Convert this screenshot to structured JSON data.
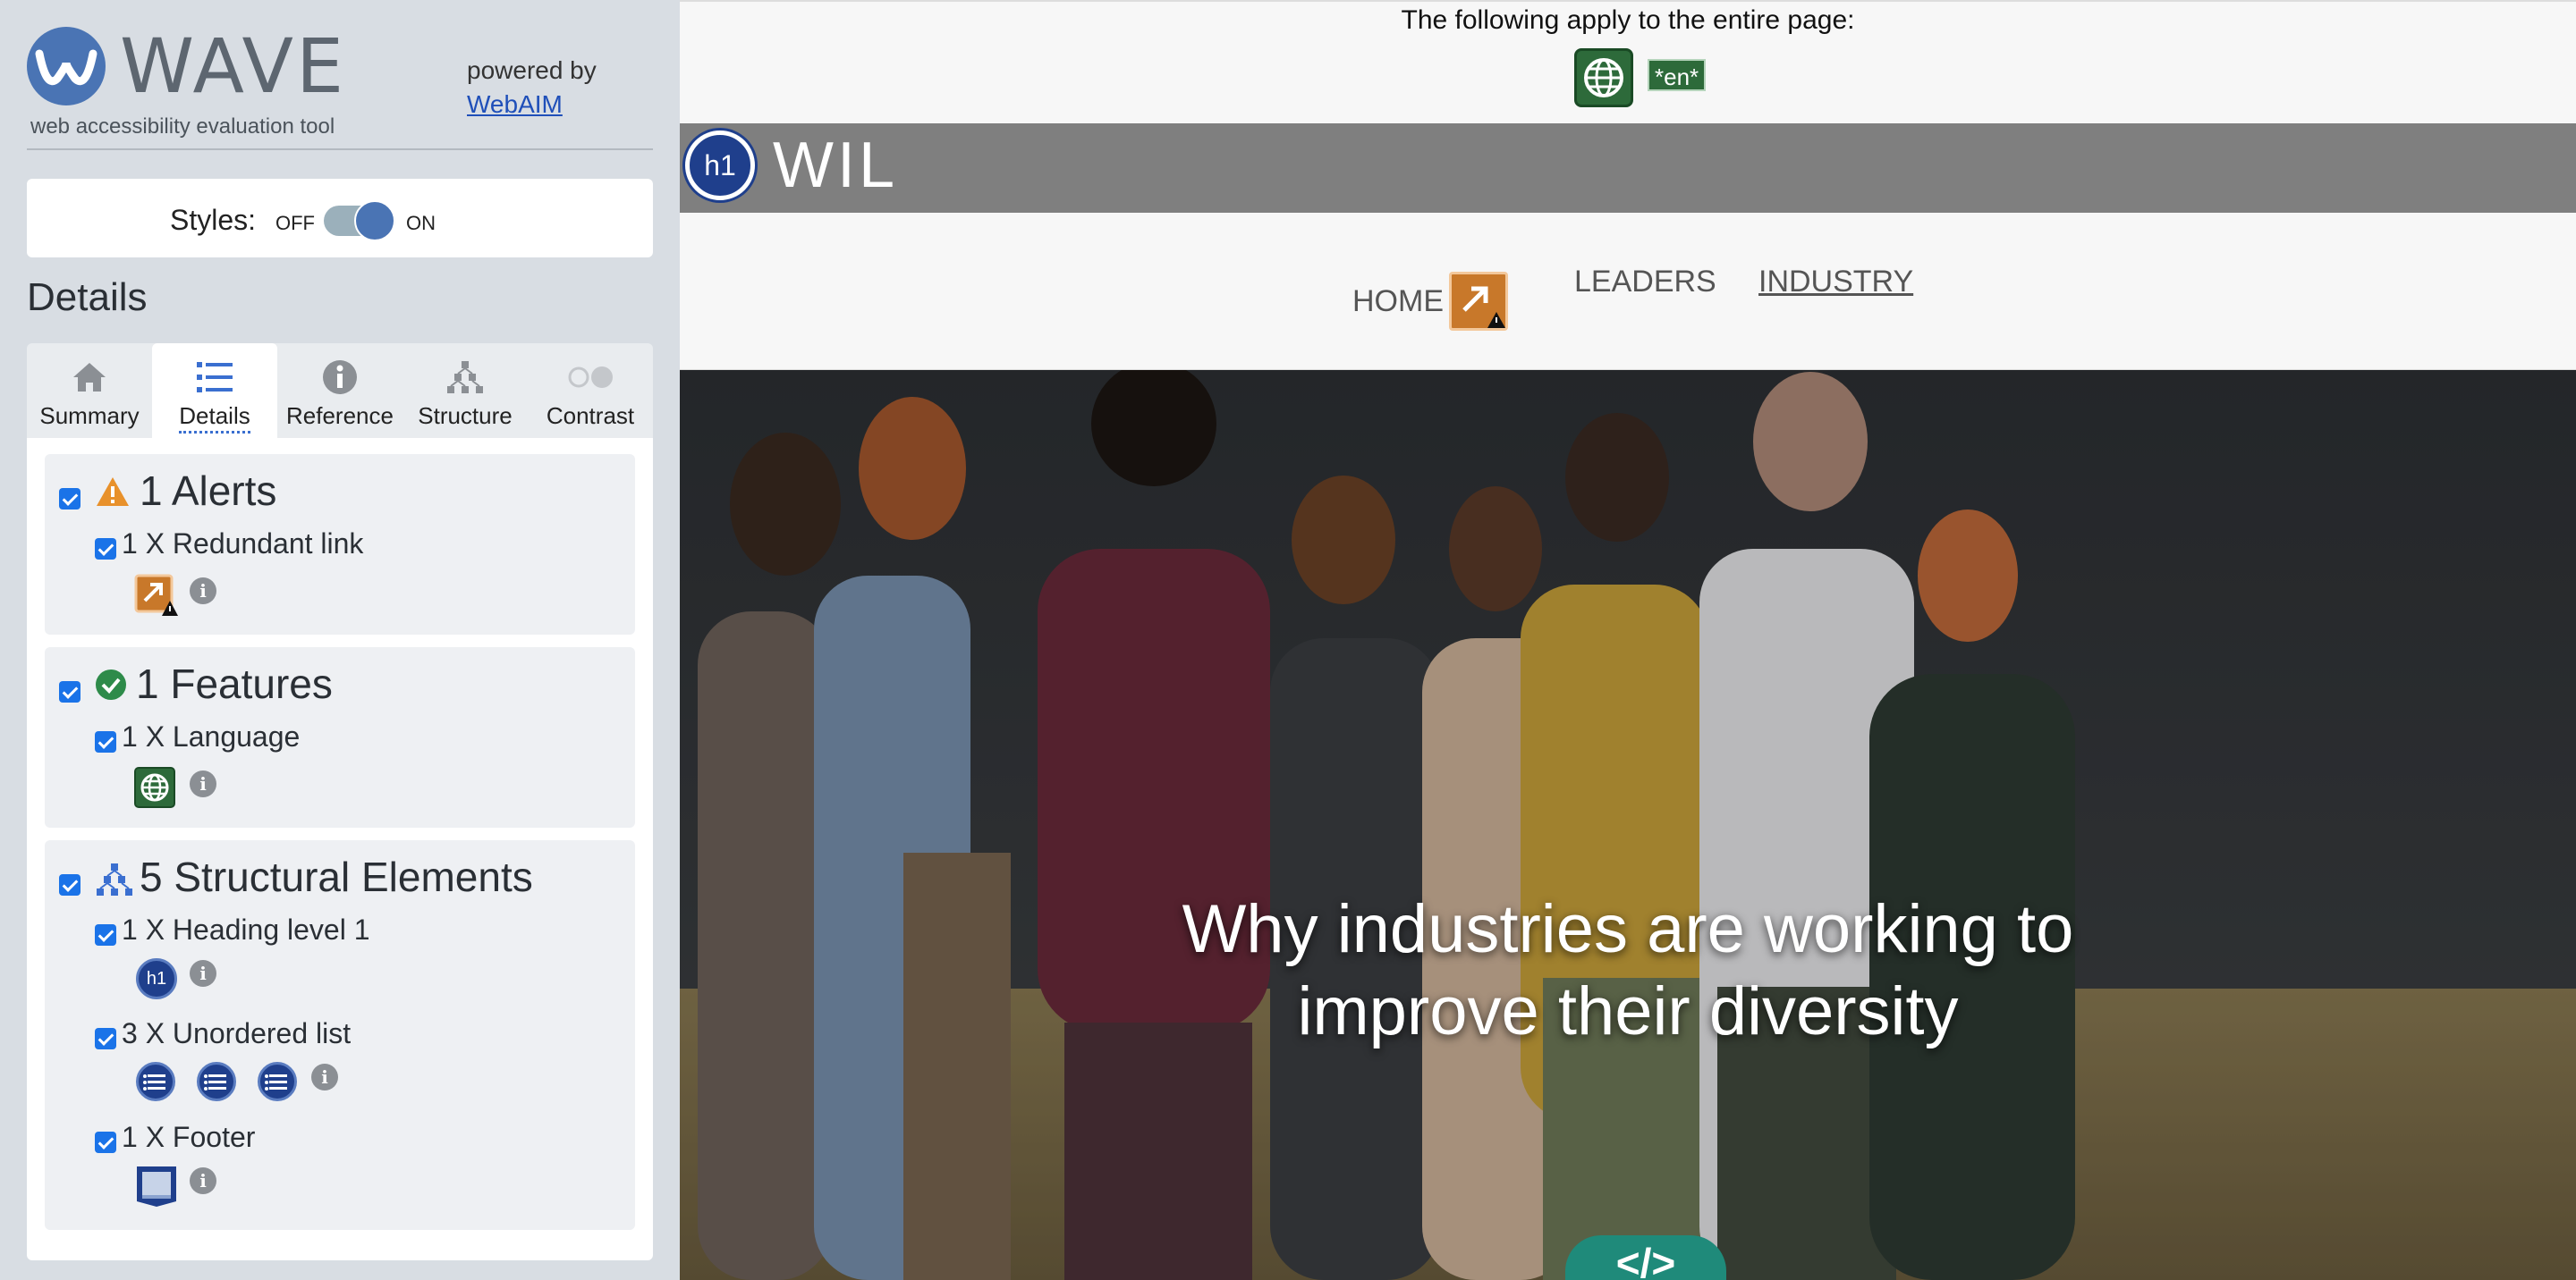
{
  "wave": {
    "logo_word": "WAVE",
    "logo_subtitle": "web accessibility evaluation tool",
    "powered_by": "powered by",
    "webaim_link": "WebAIM",
    "styles_label": "Styles:",
    "styles_off": "OFF",
    "styles_on": "ON",
    "styles_state": "on",
    "details_heading": "Details",
    "tabs": [
      {
        "label": "Summary",
        "icon": "home-icon"
      },
      {
        "label": "Details",
        "icon": "list-icon",
        "active": true
      },
      {
        "label": "Reference",
        "icon": "info-icon"
      },
      {
        "label": "Structure",
        "icon": "structure-icon"
      },
      {
        "label": "Contrast",
        "icon": "contrast-icon"
      }
    ],
    "groups": {
      "alerts": {
        "title": "1 Alerts",
        "items": [
          {
            "label": "1 X Redundant link",
            "icon": "redundant-link-icon"
          }
        ]
      },
      "features": {
        "title": "1 Features",
        "items": [
          {
            "label": "1 X Language",
            "icon": "language-icon"
          }
        ]
      },
      "structural": {
        "title": "5 Structural Elements",
        "items": [
          {
            "label": "1 X Heading level 1",
            "icon": "h1-icon",
            "icon_text": "h1"
          },
          {
            "label": "3 X Unordered list",
            "icon": "unordered-list-icon"
          },
          {
            "label": "1 X Footer",
            "icon": "footer-icon"
          }
        ]
      }
    },
    "colors": {
      "accent": "#4a74b4",
      "checkbox": "#1a73e8",
      "alert": "#e8912b",
      "feature": "#2d6a3a"
    }
  },
  "page": {
    "apply_text": "The following apply to the entire page:",
    "lang_tag": "*en*",
    "h1_badge": "h1",
    "site_title": "WIL",
    "nav": [
      "HOME",
      "LEADERS",
      "INDUSTRY"
    ],
    "hero_title_line1": "Why industries are working to",
    "hero_title_line2": "improve their diversity",
    "code_badge": "</>"
  }
}
